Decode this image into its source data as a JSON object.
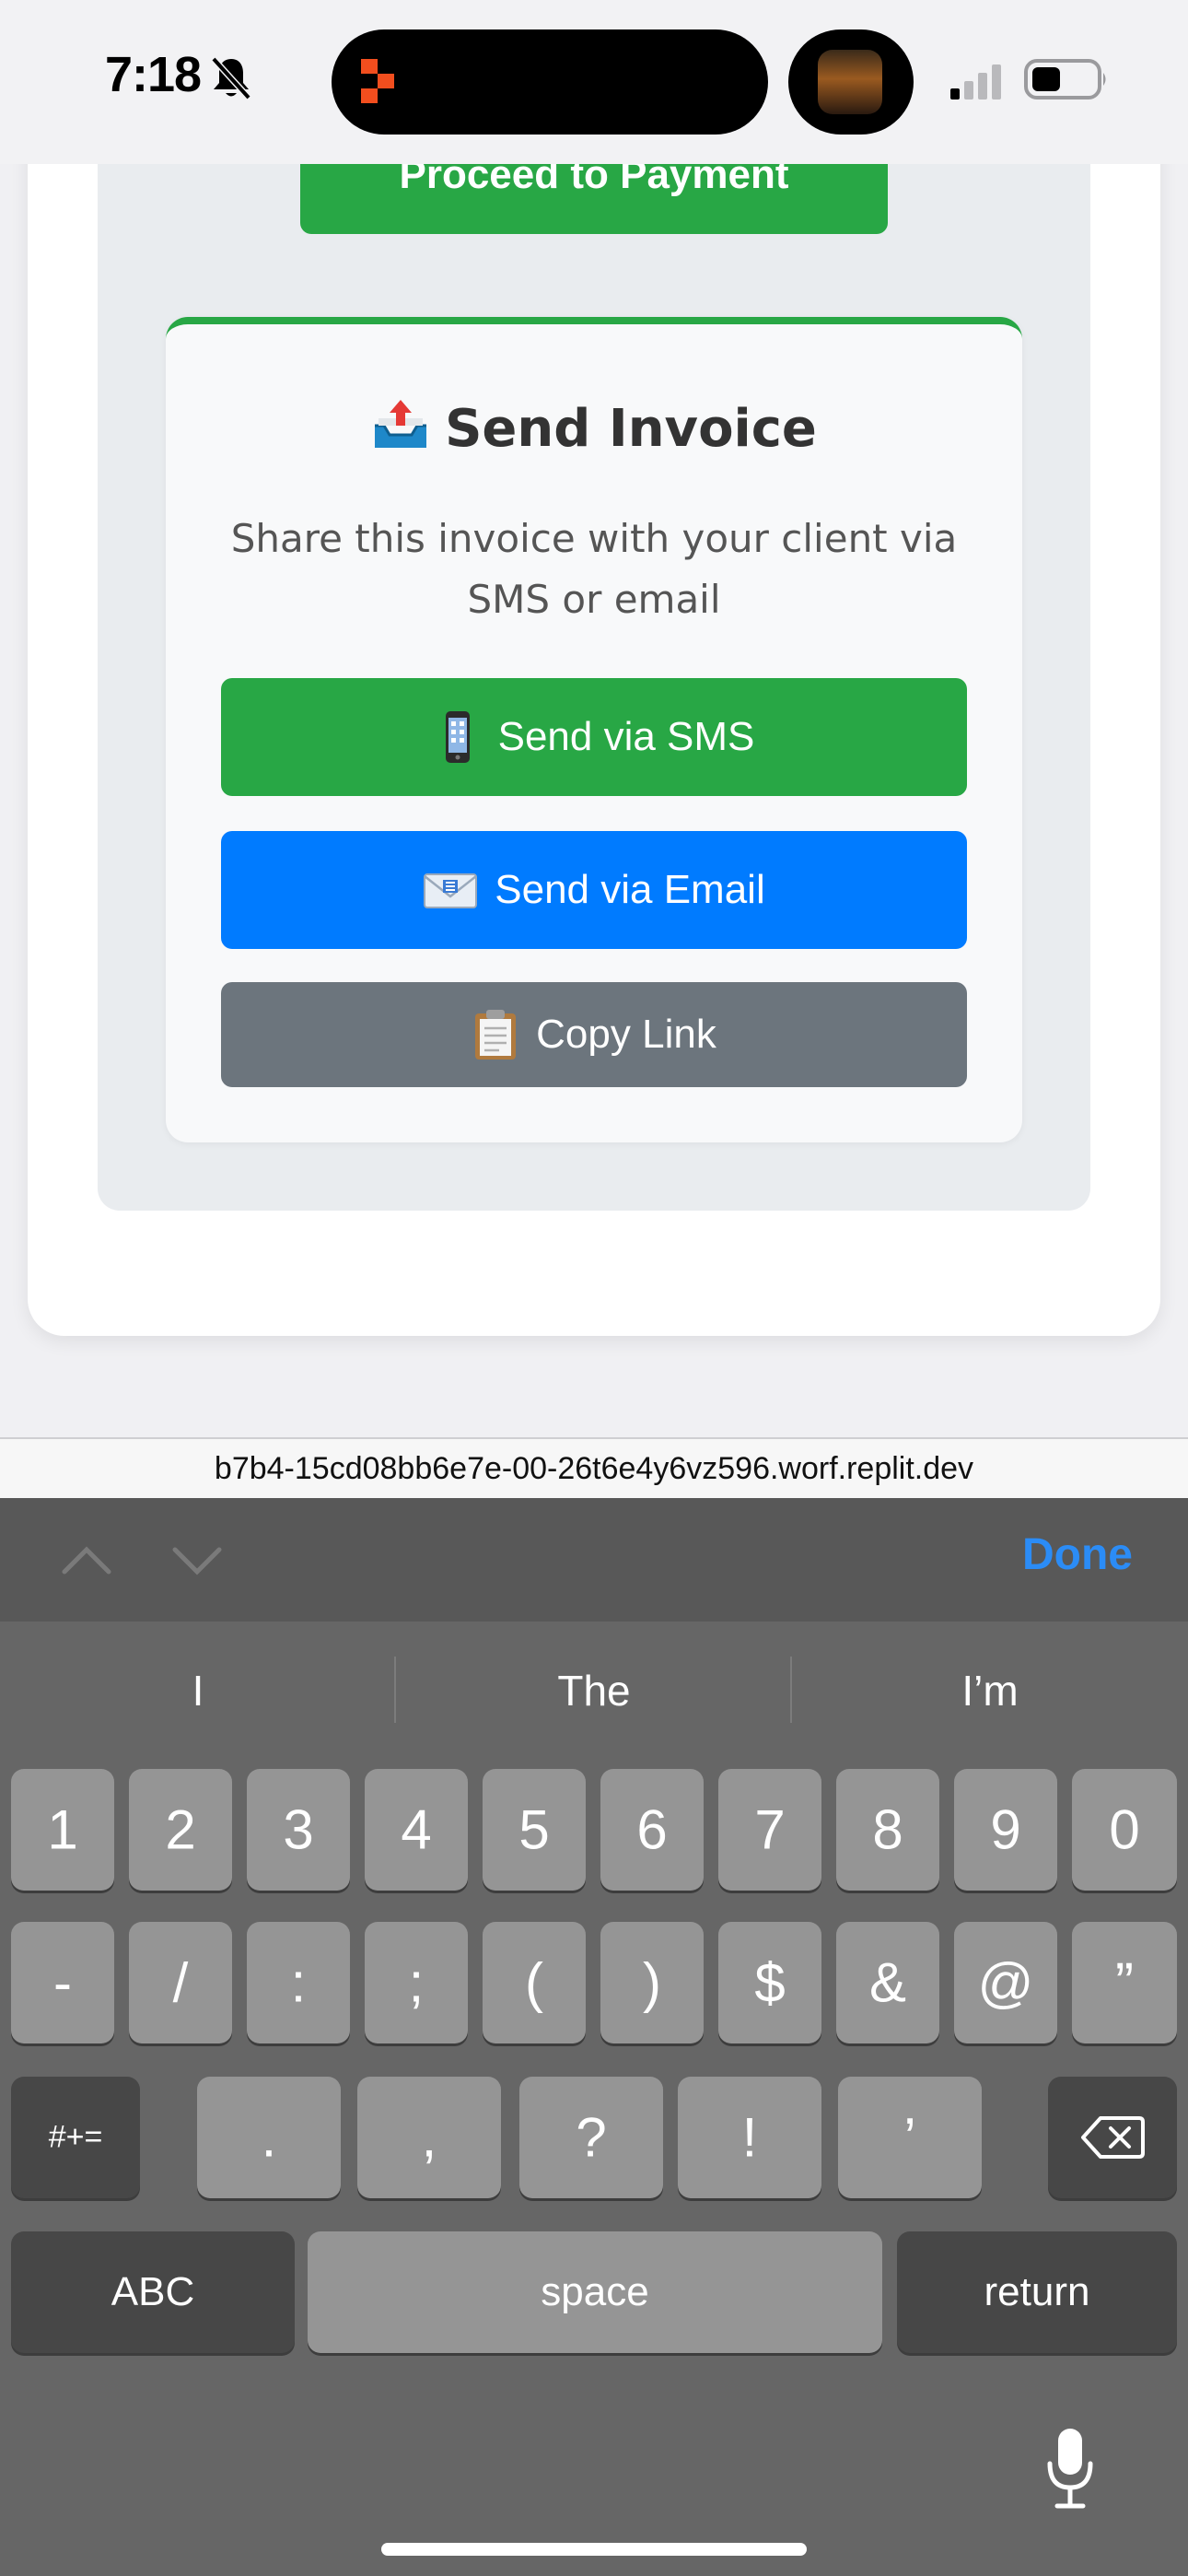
{
  "status_bar": {
    "time": "7:18"
  },
  "payment": {
    "proceed_label": "Proceed to Payment"
  },
  "invoice": {
    "title": "Send Invoice",
    "description": "Share this invoice with your client via SMS or email",
    "sms_label": "Send via SMS",
    "email_label": "Send via Email",
    "copy_label": "Copy Link"
  },
  "browser": {
    "url": "b7b4-15cd08bb6e7e-00-26t6e4y6vz596.worf.replit.dev"
  },
  "keyboard": {
    "done_label": "Done",
    "suggestions": [
      "I",
      "The",
      "I’m"
    ],
    "row1": [
      "1",
      "2",
      "3",
      "4",
      "5",
      "6",
      "7",
      "8",
      "9",
      "0"
    ],
    "row2": [
      "-",
      "/",
      ":",
      ";",
      "(",
      ")",
      "$",
      "&",
      "@",
      "”"
    ],
    "row3": [
      ".",
      ",",
      "?",
      "!",
      "’"
    ],
    "symbols_label": "#+=",
    "abc_label": "ABC",
    "space_label": "space",
    "return_label": "return"
  },
  "colors": {
    "green": "#28a745",
    "blue": "#007bff",
    "gray": "#6c757d",
    "done_blue": "#2b8cf6"
  }
}
